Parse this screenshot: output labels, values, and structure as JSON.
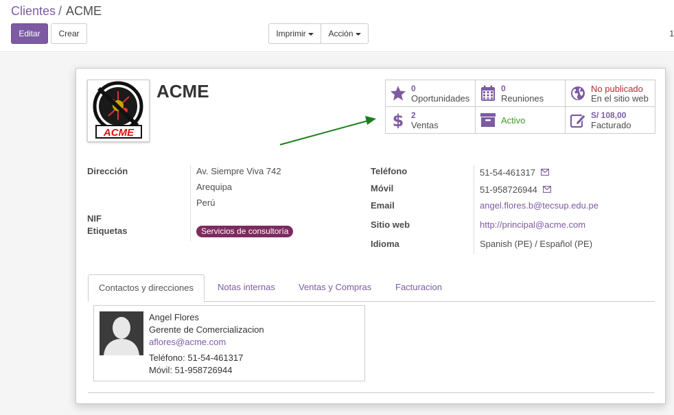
{
  "breadcrumb": {
    "parent": "Clientes",
    "separator": "/",
    "current": "ACME"
  },
  "toolbar": {
    "edit_label": "Editar",
    "create_label": "Crear",
    "print_label": "Imprimir",
    "action_label": "Acción",
    "pager_stub": "1"
  },
  "partner": {
    "name": "ACME",
    "logo_text": "ACME"
  },
  "smart_buttons": {
    "opportunities": {
      "count": "0",
      "label": "Oportunidades",
      "icon": "star-icon"
    },
    "meetings": {
      "count": "0",
      "label": "Reuniones",
      "icon": "calendar-icon"
    },
    "website": {
      "status": "No publicado",
      "label": "En el sitio web",
      "icon": "globe-icon"
    },
    "sales": {
      "count": "2",
      "label": "Ventas",
      "icon": "dollar-icon"
    },
    "active": {
      "label": "Activo",
      "icon": "archive-icon"
    },
    "invoiced": {
      "amount": "S/ 108,00",
      "label": "Facturado",
      "icon": "edit-icon"
    }
  },
  "fields_left": {
    "address_label": "Dirección",
    "street": "Av. Siempre Viva 742",
    "city": "Arequipa",
    "country": "Perú",
    "vat_label": "NIF",
    "tags_label": "Etiquetas",
    "tag": "Servicios de consultoría"
  },
  "fields_right": {
    "phone_label": "Teléfono",
    "phone": "51-54-461317",
    "mobile_label": "Móvil",
    "mobile": "51-958726944",
    "email_label": "Email",
    "email": "angel.flores.b@tecsup.edu.pe",
    "website_label": "Sitio web",
    "website": "http://principal@acme.com",
    "lang_label": "Idioma",
    "lang": "Spanish (PE) / Español (PE)"
  },
  "tabs": [
    {
      "label": "Contactos y direcciones",
      "active": true
    },
    {
      "label": "Notas internas",
      "active": false
    },
    {
      "label": "Ventas y Compras",
      "active": false
    },
    {
      "label": "Facturacion",
      "active": false
    }
  ],
  "contact": {
    "name": "Angel Flores",
    "function": "Gerente de Comercializacion",
    "email": "aflores@acme.com",
    "phone": "Teléfono: 51-54-461317",
    "mobile": "Móvil: 51-958726944"
  },
  "colors": {
    "brand": "#7c5ba3",
    "tag": "#7d2a5e",
    "active_green": "#3a9d23",
    "unpublished_red": "#b03030",
    "arrow": "#1a7f1a"
  }
}
